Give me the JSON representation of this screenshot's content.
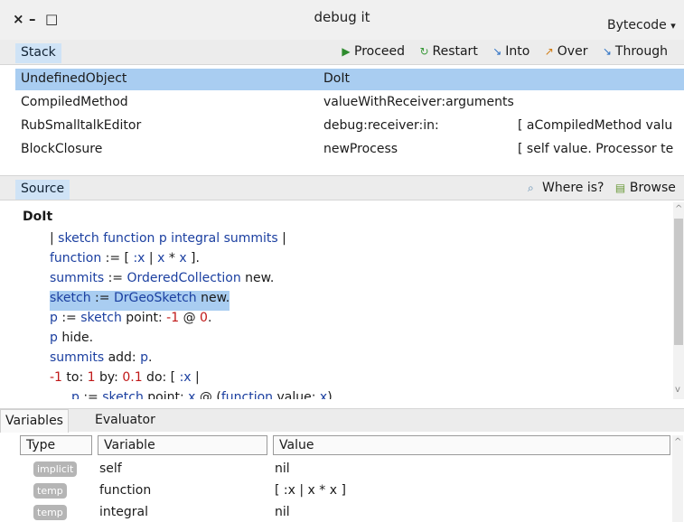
{
  "window": {
    "title": "debug it",
    "controls": [
      "×",
      "–",
      "□"
    ],
    "bytecode_label": "Bytecode",
    "bytecode_arrow": "▾"
  },
  "stack_panel": {
    "tab_label": "Stack",
    "toolbar": [
      {
        "icon": "proceed-icon",
        "glyph": "▶",
        "label": "Proceed"
      },
      {
        "icon": "restart-icon",
        "glyph": "↻",
        "label": "Restart"
      },
      {
        "icon": "into-icon",
        "glyph": "↘",
        "label": "Into"
      },
      {
        "icon": "over-icon",
        "glyph": "↗",
        "label": "Over"
      },
      {
        "icon": "through-icon",
        "glyph": "↘",
        "label": "Through"
      }
    ],
    "rows": [
      {
        "receiver": "UndefinedObject",
        "method": "DoIt",
        "extra": "",
        "selected": true
      },
      {
        "receiver": "CompiledMethod",
        "method": "valueWithReceiver:arguments",
        "extra": "",
        "selected": false
      },
      {
        "receiver": "RubSmalltalkEditor",
        "method": "debug:receiver:in:",
        "extra": "[ aCompiledMethod  valu",
        "selected": false
      },
      {
        "receiver": "BlockClosure",
        "method": "newProcess",
        "extra": "[ self value. Processor te",
        "selected": false
      }
    ]
  },
  "source_panel": {
    "tab_label": "Source",
    "where_is_label": "Where is?",
    "browse_label": "Browse",
    "method_name": "DoIt",
    "lines": [
      "| sketch function p integral summits |",
      "function := [ :x | x * x ].",
      "summits := OrderedCollection new.",
      "sketch := DrGeoSketch new.",
      "p := sketch point: -1 @ 0.",
      "p hide.",
      "summits add: p.",
      "-1 to: 1 by: 0.1 do: [ :x |",
      "p := sketch point: x @ (function value: x)."
    ]
  },
  "variables_panel": {
    "tabs": [
      "Variables",
      "Evaluator"
    ],
    "columns": [
      "Type",
      "Variable",
      "Value"
    ],
    "rows": [
      {
        "type": "implicit",
        "name": "self",
        "value": "nil"
      },
      {
        "type": "temp",
        "name": "function",
        "value": "[ :x | x * x ]"
      },
      {
        "type": "temp",
        "name": "integral",
        "value": "nil"
      }
    ]
  },
  "colors": {
    "selection": "#a9cdf1",
    "code_blue": "#1b3fa0",
    "code_red": "#c01818",
    "header_bg": "#ececec",
    "badge": "#b5b5b5"
  }
}
